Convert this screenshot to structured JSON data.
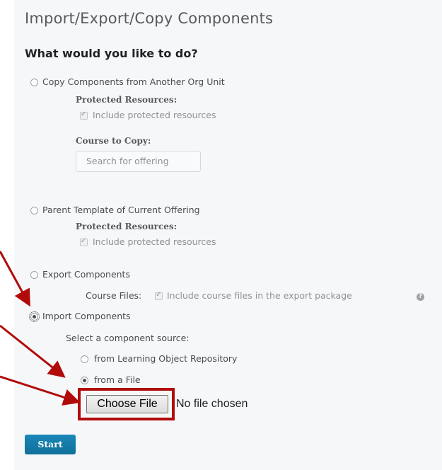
{
  "page": {
    "title": "Import/Export/Copy Components",
    "question": "What would you like to do?"
  },
  "options": {
    "copy": {
      "label": "Copy Components from Another Org Unit",
      "protected_heading": "Protected Resources:",
      "protected_checkbox": "Include protected resources",
      "course_heading": "Course to Copy:",
      "search_button": "Search for offering"
    },
    "parent": {
      "label": "Parent Template of Current Offering",
      "protected_heading": "Protected Resources:",
      "protected_checkbox": "Include protected resources"
    },
    "export": {
      "label": "Export Components",
      "course_files_label": "Course Files:",
      "course_files_checkbox": "Include course files in the export package"
    },
    "import": {
      "label": "Import Components",
      "source_prompt": "Select a component source:",
      "source_repo": "from Learning Object Repository",
      "source_file": "from a File",
      "choose_file_button": "Choose File",
      "no_file_text": "No file chosen"
    }
  },
  "actions": {
    "start_label": "Start"
  },
  "colors": {
    "start_button": "#1a80ad",
    "annotation": "#b10a0a"
  }
}
